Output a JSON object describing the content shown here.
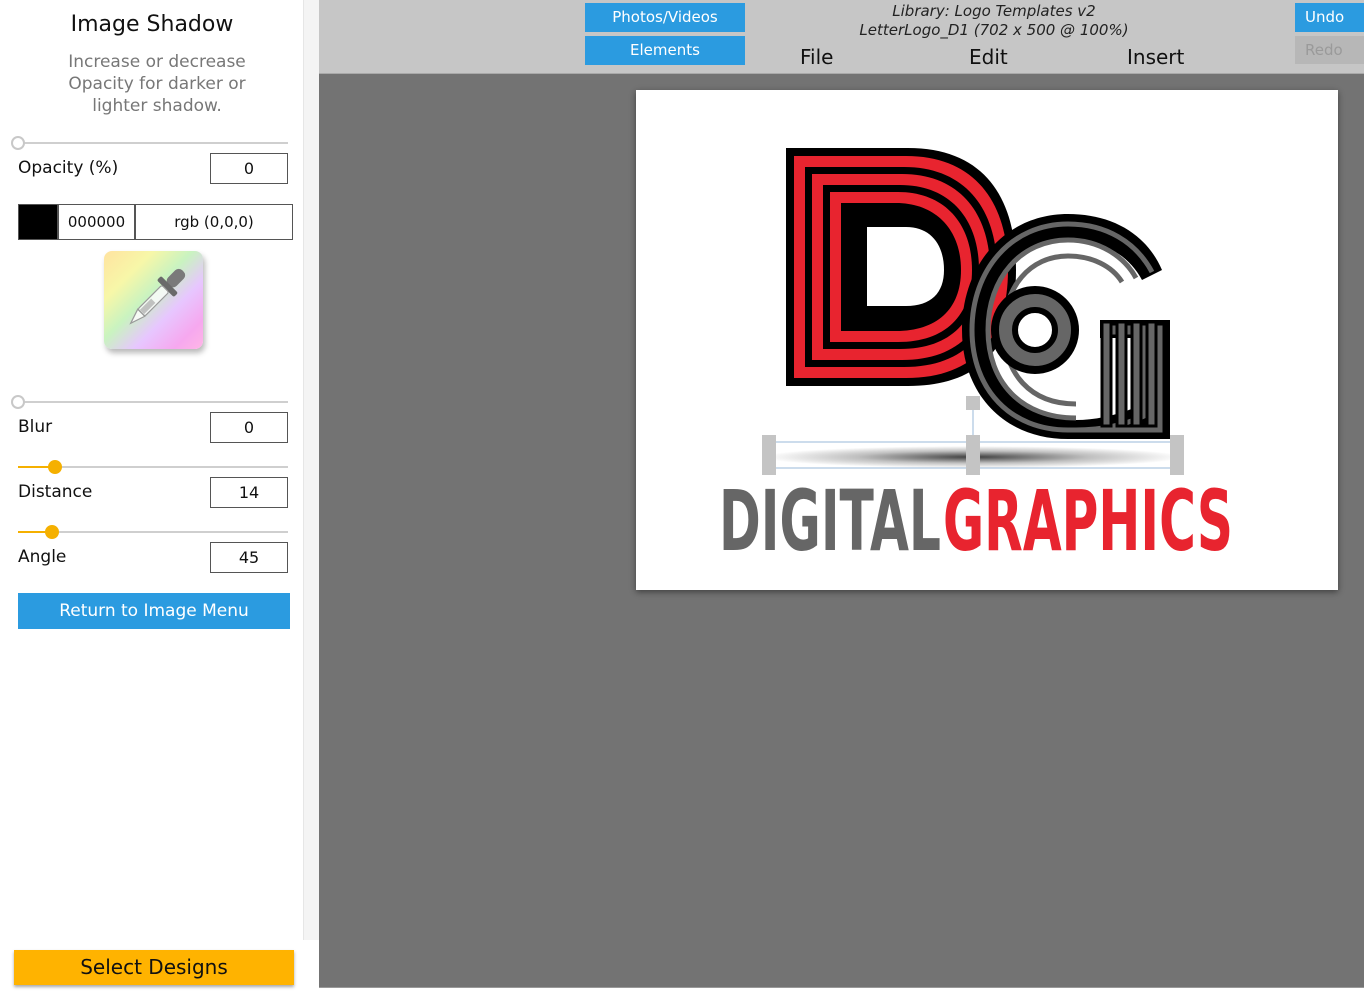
{
  "left_panel": {
    "title": "Image Shadow",
    "description": "Increase or decrease Opacity for darker or lighter shadow.",
    "opacity": {
      "label": "Opacity (%)",
      "value": "0",
      "level": 0
    },
    "color": {
      "swatch": "#000000",
      "hex": "000000",
      "rgb": "rgb (0,0,0)",
      "picker_icon": "eyedropper-icon"
    },
    "blur": {
      "label": "Blur",
      "value": "0",
      "level": 0
    },
    "distance": {
      "label": "Distance",
      "value": "14",
      "level": 14
    },
    "angle": {
      "label": "Angle",
      "value": "45",
      "level": 45
    },
    "return_button": "Return to Image Menu",
    "select_designs_button": "Select Designs"
  },
  "top_bar": {
    "photos_videos_button": "Photos/Videos",
    "elements_button": "Elements",
    "library_line": "Library: Logo Templates v2",
    "file_line": "LetterLogo_D1 (702 x 500 @ 100%)",
    "menu": [
      "File",
      "Edit",
      "Insert"
    ],
    "undo_button": "Undo",
    "redo_button": "Redo"
  },
  "canvas": {
    "logo_text_left": "DIGITAL",
    "logo_text_right": "GRAPHICS",
    "colors": {
      "red": "#e8242f",
      "grey": "#666666",
      "black": "#000000",
      "accent": "#2b9be0",
      "slider_active": "#f5b000",
      "workspace": "#737373"
    }
  }
}
